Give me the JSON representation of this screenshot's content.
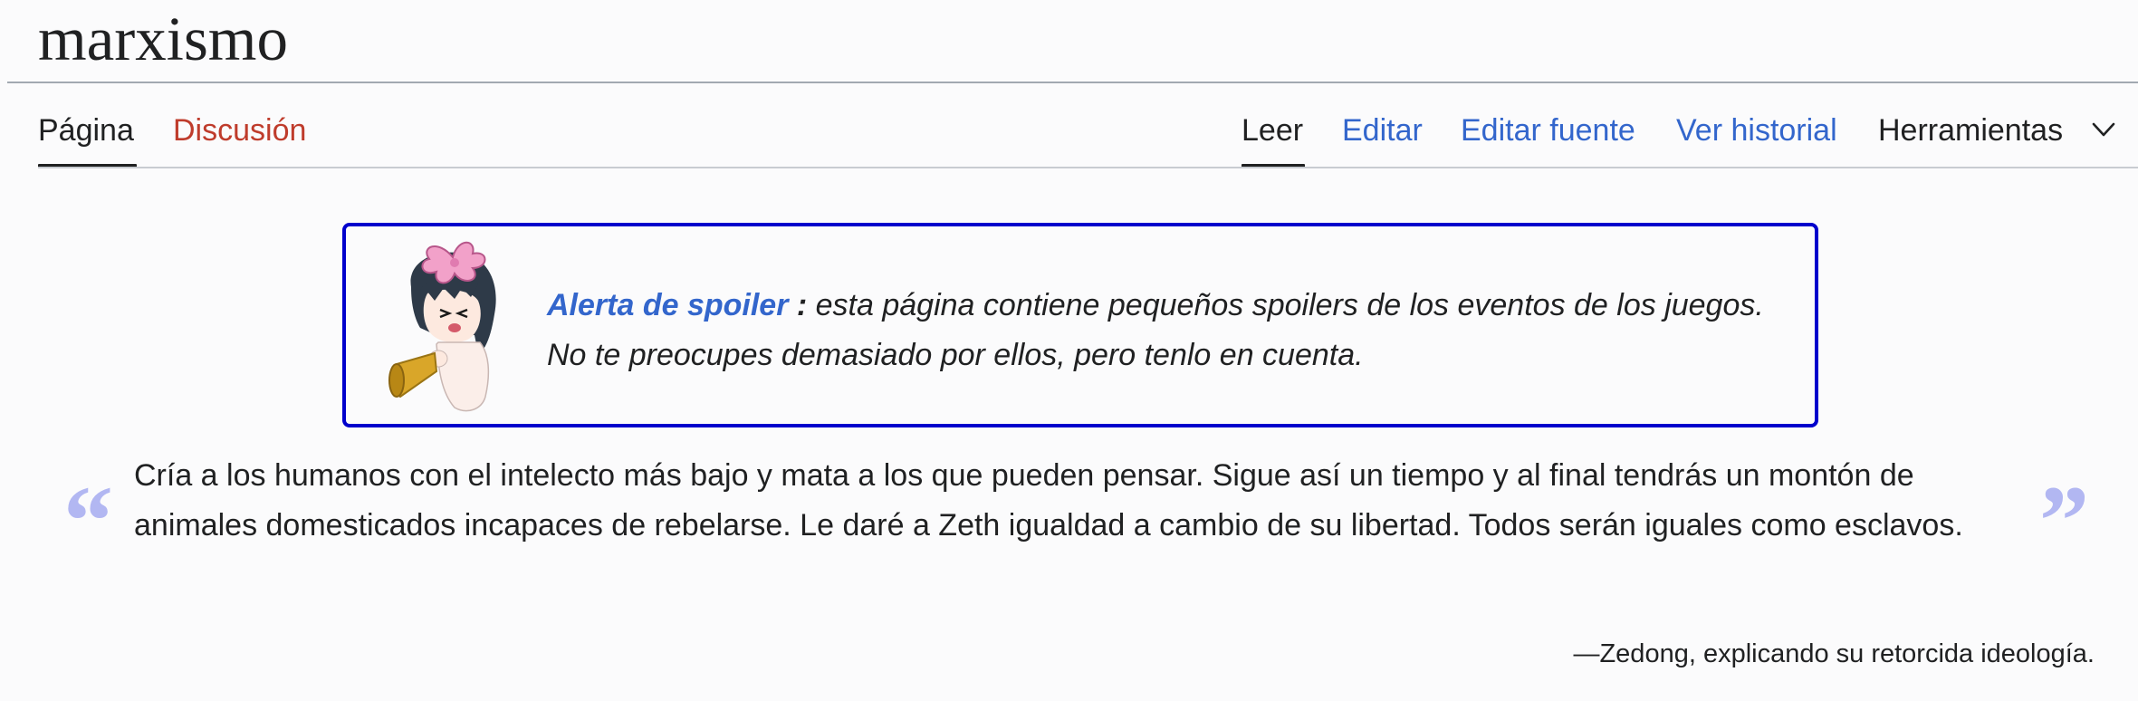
{
  "page": {
    "title": "marxismo"
  },
  "tabs_left": [
    {
      "label": "Página"
    },
    {
      "label": "Discusión"
    }
  ],
  "tabs_right": [
    {
      "label": "Leer"
    },
    {
      "label": "Editar"
    },
    {
      "label": "Editar fuente"
    },
    {
      "label": "Ver historial"
    },
    {
      "label": "Herramientas"
    }
  ],
  "spoiler": {
    "link_label": "Alerta de spoiler",
    "colon": " :",
    "line1_rest": " esta página contiene pequeños spoilers de los eventos de los juegos.",
    "line2": "No te preocupes demasiado por ellos, pero tenlo en cuenta.",
    "border_color": "#0000cc",
    "image_icon": "megaphone-character-icon"
  },
  "quote": {
    "open_mark": "“",
    "close_mark": "”",
    "text": "Cría a los humanos con el intelecto más bajo y mata a los que pueden pensar. Sigue así un tiempo y al final tendrás un montón de animales domesticados incapaces de rebelarse. Le daré a Zeth igualdad a cambio de su libertad. Todos serán iguales como esclavos.",
    "attribution": "—Zedong, explicando su retorcida ideología."
  },
  "colors": {
    "link": "#3366cc",
    "new_link": "#bf3c2c",
    "quote_marks": "#b2b7f2",
    "text": "#202122"
  }
}
